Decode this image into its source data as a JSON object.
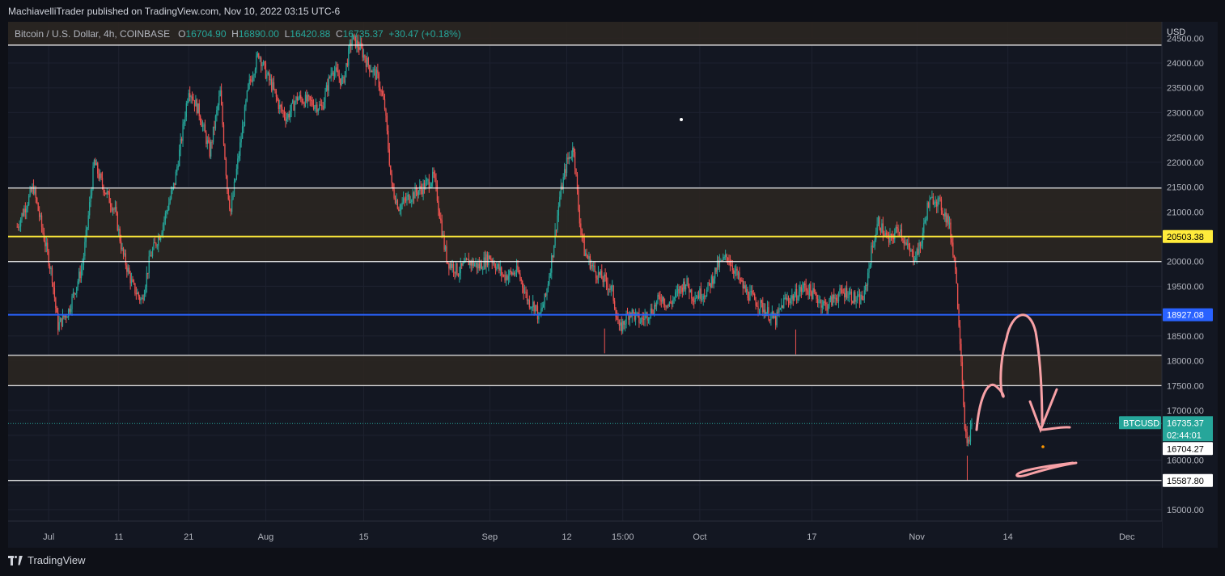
{
  "publication": {
    "text": "MachiavelliTrader published on TradingView.com, Nov 10, 2022 03:15 UTC-6"
  },
  "legend": {
    "symbol": "Bitcoin / U.S. Dollar, 4h, COINBASE",
    "open_label": "O",
    "open": "16704.90",
    "high_label": "H",
    "high": "16890.00",
    "low_label": "L",
    "low": "16420.88",
    "close_label": "C",
    "close": "16735.37",
    "change": "+30.47 (+0.18%)"
  },
  "footer": {
    "brand": "TradingView"
  },
  "colors": {
    "up": "#26a69a",
    "down": "#ef5350",
    "yellow_line": "#ffeb3b",
    "blue_line": "#2962ff",
    "zone": "#2b2621",
    "annotation": "#f7a1a6",
    "text": "#d1d4dc"
  },
  "chart_data": {
    "type": "candlestick",
    "currency": "USD",
    "timeframe": "4h",
    "y_ticks": [
      15000,
      15500,
      16000,
      16500,
      17000,
      17500,
      18000,
      18500,
      19000,
      19500,
      20000,
      20500,
      21000,
      21500,
      22000,
      22500,
      23000,
      23500,
      24000,
      24500
    ],
    "y_tick_labels": [
      "15000.00",
      "",
      "16000.00",
      "16500.00",
      "17000.00",
      "17500.00",
      "18000.00",
      "18500.00",
      "",
      "19500.00",
      "20000.00",
      "",
      "21000.00",
      "21500.00",
      "22000.00",
      "22500.00",
      "23000.00",
      "23500.00",
      "24000.00",
      "24500.00"
    ],
    "ylim": [
      14770,
      24830
    ],
    "x_axis_labels": [
      {
        "label": "Jul",
        "t": 4.5
      },
      {
        "label": "11",
        "t": 14.5
      },
      {
        "label": "21",
        "t": 24.5
      },
      {
        "label": "Aug",
        "t": 35.5
      },
      {
        "label": "15",
        "t": 49.5
      },
      {
        "label": "Sep",
        "t": 67.5
      },
      {
        "label": "12",
        "t": 78.5
      },
      {
        "label": "15:00",
        "t": 86.5
      },
      {
        "label": "Oct",
        "t": 97.5
      },
      {
        "label": "17",
        "t": 113.5
      },
      {
        "label": "Nov",
        "t": 128.5
      },
      {
        "label": "14",
        "t": 141.5
      },
      {
        "label": "Dec",
        "t": 158.5
      }
    ],
    "x_range_days": [
      -1.3,
      163.5
    ],
    "zones": [
      {
        "from": 20000,
        "to": 21480
      },
      {
        "from": 17500,
        "to": 18110
      },
      {
        "from": 24360,
        "to": 24830
      }
    ],
    "horizontal_lines": [
      {
        "price": 24360,
        "color": "#ffffff"
      },
      {
        "price": 21480,
        "color": "#ffffff"
      },
      {
        "price": 20503.38,
        "color": "#ffeb3b",
        "label": "20503.38"
      },
      {
        "price": 20000,
        "color": "#ffffff"
      },
      {
        "price": 18927.08,
        "color": "#2962ff",
        "label": "18927.08"
      },
      {
        "price": 18110,
        "color": "#ffffff"
      },
      {
        "price": 17500,
        "color": "#ffffff"
      },
      {
        "price": 15587.8,
        "color": "#ffffff",
        "label": "15587.80"
      }
    ],
    "price_labels": [
      {
        "text": "16735.37",
        "price": 16735.37,
        "style": "last"
      },
      {
        "text": "02:44:01",
        "style": "countdown"
      },
      {
        "text": "16704.27",
        "price": 16704.27,
        "style": "plain"
      }
    ],
    "last_price_symbol": "BTCUSD",
    "last_price": 16735.37,
    "anchors": [
      [
        0,
        20700
      ],
      [
        2.3,
        21500
      ],
      [
        5,
        19700
      ],
      [
        5.8,
        18700
      ],
      [
        7.3,
        19000
      ],
      [
        9.3,
        19900
      ],
      [
        10,
        20700
      ],
      [
        11,
        22000
      ],
      [
        12,
        21600
      ],
      [
        14,
        21000
      ],
      [
        15,
        20200
      ],
      [
        16.5,
        19500
      ],
      [
        17.8,
        19200
      ],
      [
        19,
        20100
      ],
      [
        20.5,
        20600
      ],
      [
        22.5,
        21600
      ],
      [
        23.5,
        22500
      ],
      [
        24.5,
        23500
      ],
      [
        26,
        23000
      ],
      [
        27.5,
        22200
      ],
      [
        29,
        23400
      ],
      [
        30,
        21500
      ],
      [
        30.5,
        21000
      ],
      [
        31.5,
        22000
      ],
      [
        33,
        23500
      ],
      [
        34.5,
        24200
      ],
      [
        35.5,
        23800
      ],
      [
        36.5,
        23500
      ],
      [
        37.5,
        23100
      ],
      [
        38.5,
        22900
      ],
      [
        40,
        23300
      ],
      [
        42,
        23200
      ],
      [
        43.5,
        23100
      ],
      [
        45,
        23900
      ],
      [
        46.5,
        23600
      ],
      [
        47.8,
        24500
      ],
      [
        49,
        24300
      ],
      [
        50,
        24000
      ],
      [
        51.5,
        23700
      ],
      [
        52.5,
        23100
      ],
      [
        53.5,
        21500
      ],
      [
        54.5,
        21100
      ],
      [
        56,
        21300
      ],
      [
        58,
        21500
      ],
      [
        59.5,
        21700
      ],
      [
        60,
        21300
      ],
      [
        61,
        20300
      ],
      [
        61.5,
        20000
      ],
      [
        63,
        19800
      ],
      [
        64.5,
        20000
      ],
      [
        66,
        19900
      ],
      [
        67.5,
        20100
      ],
      [
        69.5,
        19700
      ],
      [
        71.5,
        19800
      ],
      [
        73,
        19200
      ],
      [
        74,
        19100
      ],
      [
        74.5,
        18850
      ],
      [
        75.5,
        19300
      ],
      [
        76.5,
        20200
      ],
      [
        77.5,
        21300
      ],
      [
        78.5,
        22000
      ],
      [
        79.5,
        22300
      ],
      [
        80.2,
        21000
      ],
      [
        81,
        20200
      ],
      [
        82.5,
        19800
      ],
      [
        84,
        19600
      ],
      [
        85,
        19400
      ],
      [
        86,
        18600
      ],
      [
        87.5,
        19000
      ],
      [
        89,
        18800
      ],
      [
        90.5,
        19000
      ],
      [
        92,
        19300
      ],
      [
        93,
        19100
      ],
      [
        94,
        19300
      ],
      [
        95.5,
        19600
      ],
      [
        96.5,
        19300
      ],
      [
        98.5,
        19400
      ],
      [
        100,
        19900
      ],
      [
        101.5,
        20100
      ],
      [
        102.5,
        19800
      ],
      [
        104,
        19400
      ],
      [
        105.5,
        19200
      ],
      [
        107,
        19000
      ],
      [
        108.3,
        18800
      ],
      [
        109.5,
        19200
      ],
      [
        111,
        19300
      ],
      [
        112.5,
        19500
      ],
      [
        114,
        19300
      ],
      [
        115.5,
        19100
      ],
      [
        117,
        19300
      ],
      [
        118.5,
        19400
      ],
      [
        120,
        19200
      ],
      [
        121,
        19300
      ],
      [
        122,
        20200
      ],
      [
        123,
        20800
      ],
      [
        124.5,
        20400
      ],
      [
        126,
        20700
      ],
      [
        127,
        20300
      ],
      [
        128,
        20100
      ],
      [
        129,
        20300
      ],
      [
        130,
        21100
      ],
      [
        131,
        21300
      ],
      [
        132,
        21100
      ],
      [
        133,
        20800
      ],
      [
        133.5,
        20400
      ],
      [
        134,
        19900
      ],
      [
        134.3,
        19200
      ],
      [
        134.7,
        18400
      ],
      [
        135,
        17600
      ],
      [
        135.3,
        16800
      ],
      [
        135.7,
        16200
      ],
      [
        136,
        16500
      ],
      [
        136.5,
        16735
      ]
    ]
  }
}
